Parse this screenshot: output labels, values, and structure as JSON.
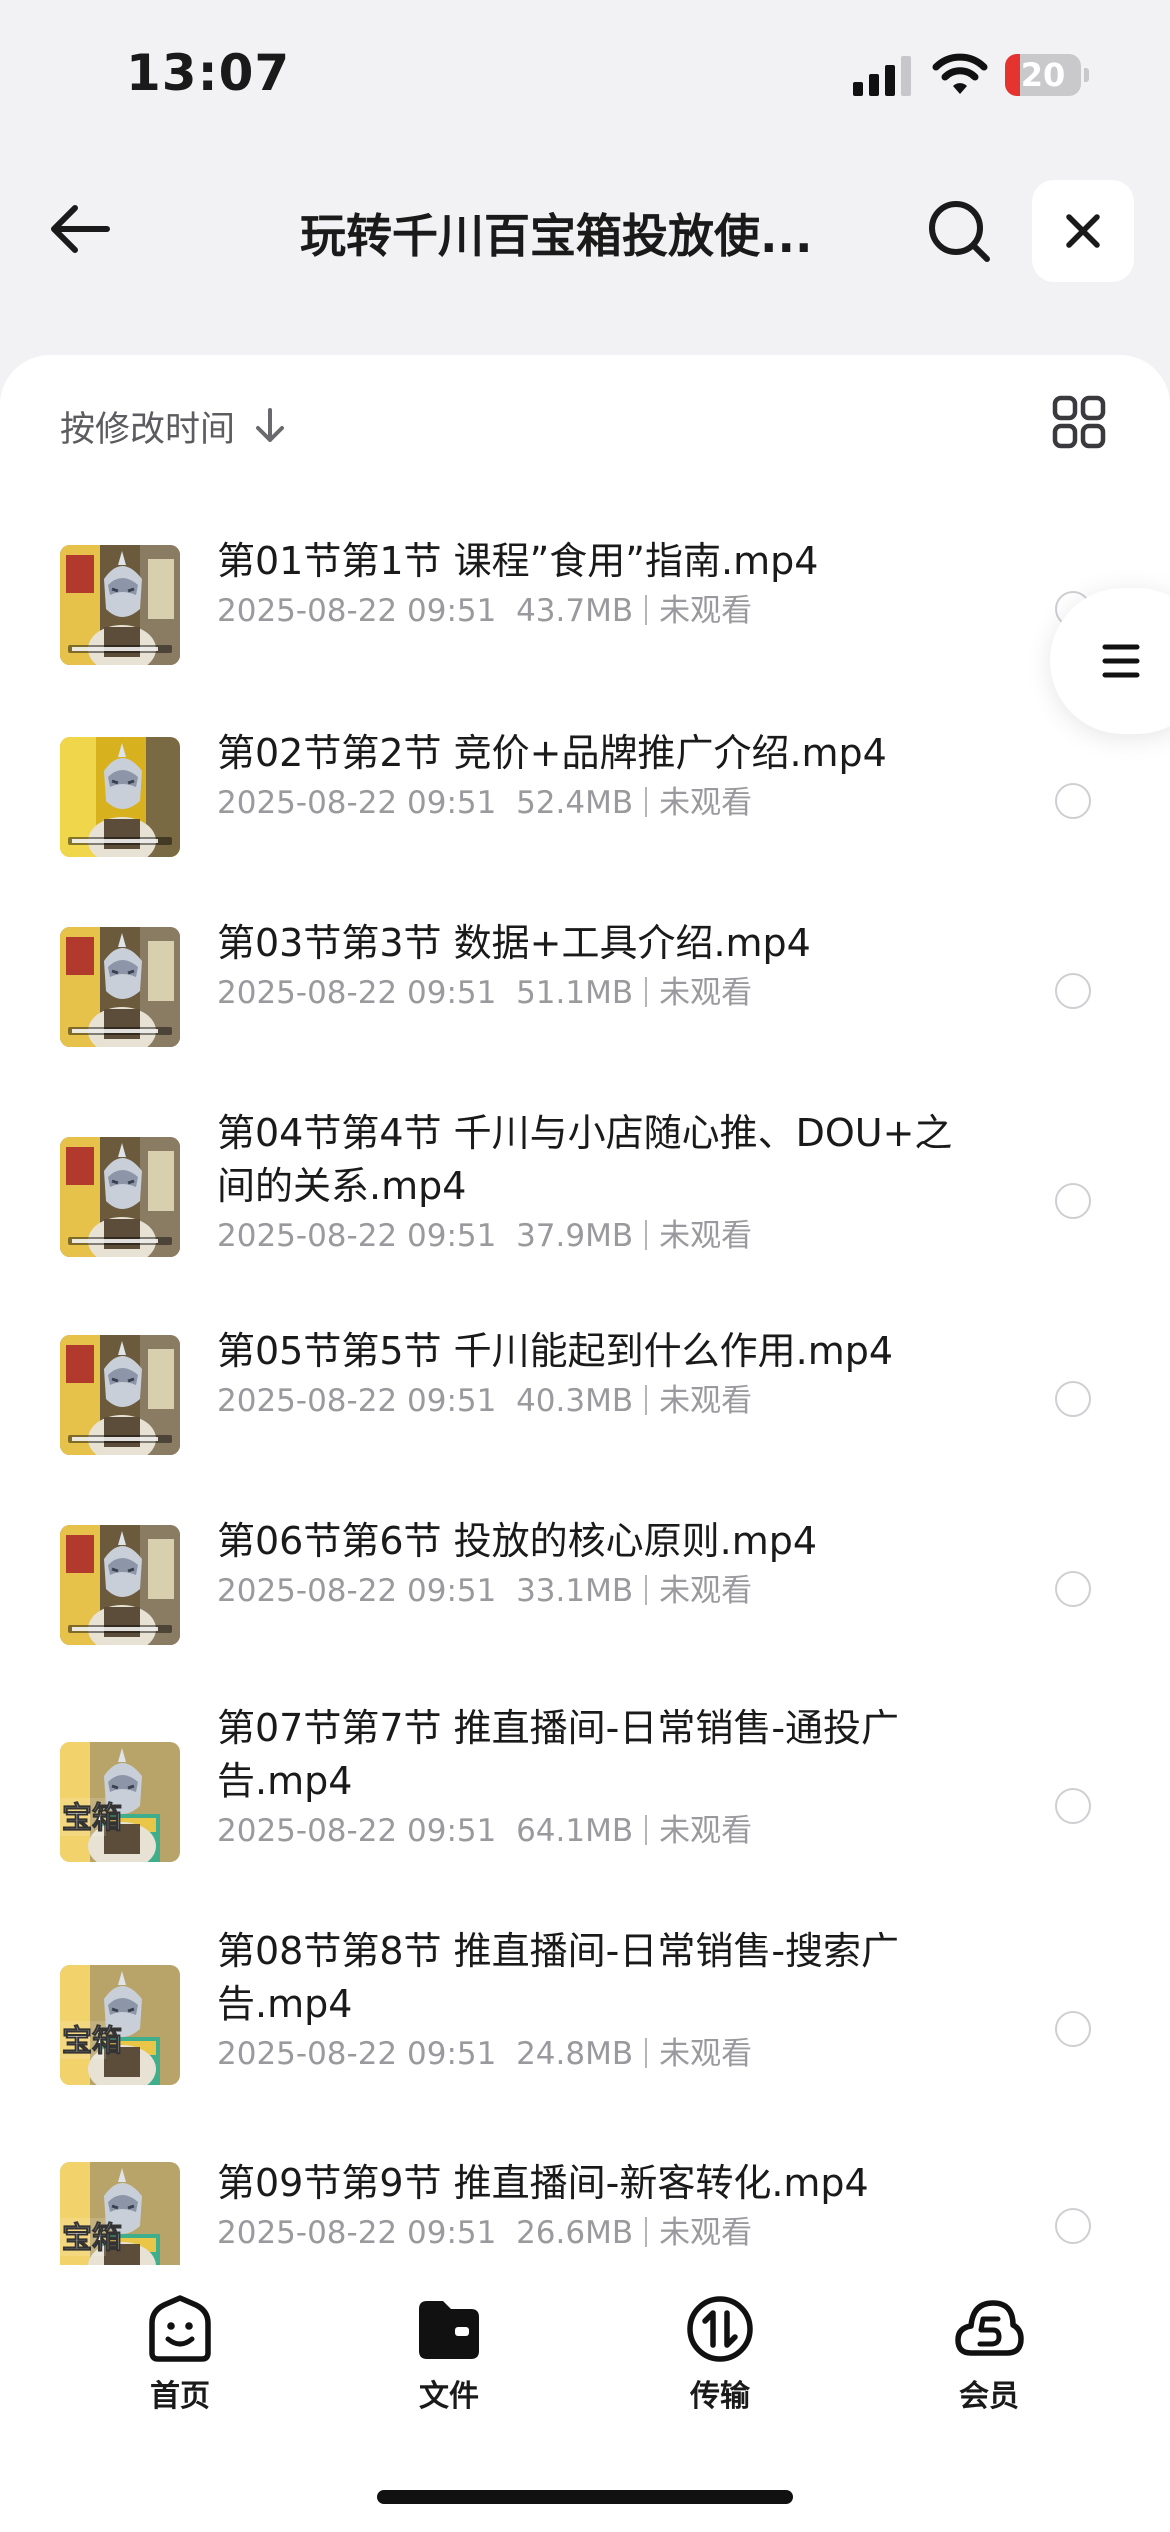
{
  "status_bar": {
    "time": "13:07",
    "battery": "20",
    "battery_level": 0.2
  },
  "header": {
    "title": "玩转千川百宝箱投放使..."
  },
  "sort": {
    "label": "按修改时间"
  },
  "files": [
    {
      "name": "第01节第1节 课程”食用”指南.mp4",
      "date": "2025-08-22 09:51",
      "size": "43.7MB",
      "status": "未观看",
      "thumb": "interview"
    },
    {
      "name": "第02节第2节 竞价+品牌推广介绍.mp4",
      "date": "2025-08-22 09:51",
      "size": "52.4MB",
      "status": "未观看",
      "thumb": "yellow"
    },
    {
      "name": "第03节第3节 数据+工具介绍.mp4",
      "date": "2025-08-22 09:51",
      "size": "51.1MB",
      "status": "未观看",
      "thumb": "interview"
    },
    {
      "name": "第04节第4节 千川与小店随心推、DOU+之间的关系.mp4",
      "date": "2025-08-22 09:51",
      "size": "37.9MB",
      "status": "未观看",
      "thumb": "interview"
    },
    {
      "name": "第05节第5节 千川能起到什么作用.mp4",
      "date": "2025-08-22 09:51",
      "size": "40.3MB",
      "status": "未观看",
      "thumb": "interview"
    },
    {
      "name": "第06节第6节 投放的核心原则.mp4",
      "date": "2025-08-22 09:51",
      "size": "33.1MB",
      "status": "未观看",
      "thumb": "interview"
    },
    {
      "name": "第07节第7节 推直播间-日常销售-通投广告.mp4",
      "date": "2025-08-22 09:51",
      "size": "64.1MB",
      "status": "未观看",
      "thumb": "box"
    },
    {
      "name": "第08节第8节  推直播间-日常销售-搜索广告.mp4",
      "date": "2025-08-22 09:51",
      "size": "24.8MB",
      "status": "未观看",
      "thumb": "box"
    },
    {
      "name": "第09节第9节 推直播间-新客转化.mp4",
      "date": "2025-08-22 09:51",
      "size": "26.6MB",
      "status": "未观看",
      "thumb": "box"
    }
  ],
  "thumb_text": "宝箱",
  "tabs": [
    {
      "label": "首页",
      "icon": "smiley-home-icon"
    },
    {
      "label": "文件",
      "icon": "folder-icon"
    },
    {
      "label": "传输",
      "icon": "transfer-arrows-icon"
    },
    {
      "label": "会员",
      "icon": "cloud-member-icon"
    }
  ],
  "colors": {
    "accent_red": "#e5332f",
    "text": "#1a1a1a",
    "meta": "#9a9a9e",
    "background": "#f2f2f4"
  }
}
